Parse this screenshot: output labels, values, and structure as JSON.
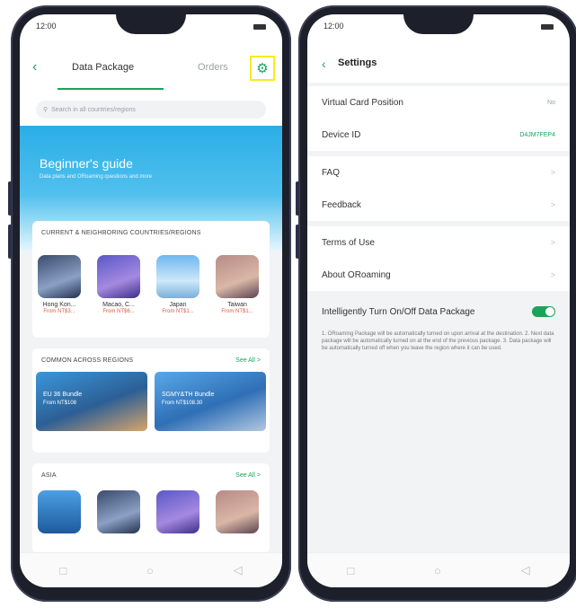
{
  "status": {
    "left_time": "12:00",
    "right_time": "12:00"
  },
  "left": {
    "tabs": {
      "active": "Data Package",
      "inactive": "Orders"
    },
    "search_placeholder": "Search in all countries/regions",
    "guide": {
      "title": "Beginner's guide",
      "subtitle": "Data plans and ORoaming questions and more"
    },
    "current_section": {
      "title": "CURRENT & NEIGHBORING COUNTRIES/REGIONS",
      "regions": [
        {
          "name": "Hong Kon...",
          "price": "From NT$3..."
        },
        {
          "name": "Macao, C...",
          "price": "From NT$6..."
        },
        {
          "name": "Japan",
          "price": "From NT$1..."
        },
        {
          "name": "Taiwan",
          "price": "From NT$1..."
        }
      ]
    },
    "common_section": {
      "title": "COMMON ACROSS REGIONS",
      "see_all": "See All >",
      "banners": [
        {
          "title": "EU 36 Bundle",
          "price": "From NT$108"
        },
        {
          "title": "SGMY&TH Bundle",
          "price": "From NT$108.30"
        }
      ]
    },
    "asia_section": {
      "title": "ASIA",
      "see_all": "See All >"
    }
  },
  "right": {
    "title": "Settings",
    "rows": [
      {
        "label": "Virtual Card Position",
        "value": "No"
      },
      {
        "label": "Device ID",
        "value": "D4JM7FEP4"
      },
      {
        "label": "FAQ",
        "value": ">"
      },
      {
        "label": "Feedback",
        "value": ">"
      },
      {
        "label": "Terms of Use",
        "value": ">"
      },
      {
        "label": "About ORoaming",
        "value": ">"
      },
      {
        "label": "Intelligently Turn On/Off Data Package",
        "value": ""
      }
    ],
    "toggle_on": true,
    "note": "1. ORoaming Package will be automatically turned on upon arrival at the destination. 2. Next data package will be automatically turned on at the end of the previous package. 3. Data package will be automatically turned off when you leave the region where it can be used."
  },
  "colors": {
    "accent": "#1aa45a",
    "highlight": "#f7ec20",
    "guide_blue": "#2aaee6"
  },
  "icons": {
    "back": "chevron-left-icon",
    "settings": "gear-icon",
    "search": "search-icon",
    "nav_recent": "square-icon",
    "nav_home": "circle-icon",
    "nav_back": "triangle-icon"
  }
}
